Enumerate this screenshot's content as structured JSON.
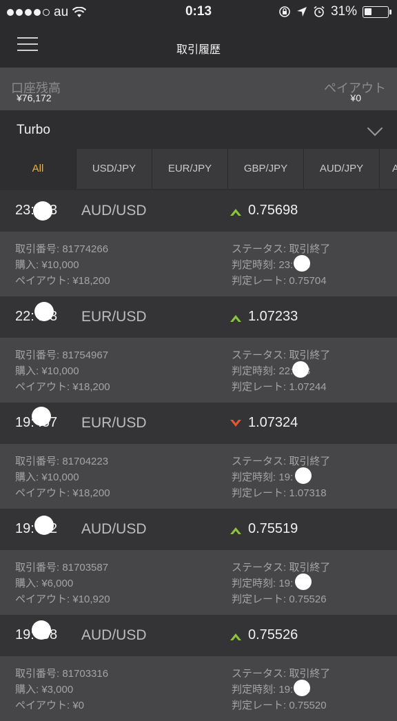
{
  "status_bar": {
    "carrier": "au",
    "time": "0:13",
    "battery": "31%",
    "battery_level": 0.31
  },
  "header": {
    "title": "取引履歴"
  },
  "balance": {
    "account_label": "口座残高",
    "account_value": "¥76,172",
    "payout_label": "ペイアウト",
    "payout_value": "¥0"
  },
  "mode": {
    "label": "Turbo"
  },
  "tabs": [
    "All",
    "USD/JPY",
    "EUR/JPY",
    "GBP/JPY",
    "AUD/JPY",
    "A"
  ],
  "colors": {
    "accent": "#f2b233",
    "up": "#8cc43f",
    "down": "#e8572e"
  },
  "trades": [
    {
      "time": "23:  :03",
      "pair": "AUD/USD",
      "direction": "up",
      "rate": "0.75698",
      "id": "取引番号: 81774266",
      "purchase": "購入: ¥10,000",
      "payout": "ペイアウト: ¥18,200",
      "status": "ステータス: 取引終了",
      "judge_time": "判定時刻: 23:  :03",
      "judge_rate": "判定レート: 0.75704"
    },
    {
      "time": "22:  :03",
      "pair": "EUR/USD",
      "direction": "up",
      "rate": "1.07233",
      "id": "取引番号: 81754967",
      "purchase": "購入: ¥10,000",
      "payout": "ペイアウト: ¥18,200",
      "status": "ステータス: 取引終了",
      "judge_time": "判定時刻: 22:  :03",
      "judge_rate": "判定レート: 1.07244"
    },
    {
      "time": "19:  :57",
      "pair": "EUR/USD",
      "direction": "down",
      "rate": "1.07324",
      "id": "取引番号: 81704223",
      "purchase": "購入: ¥10,000",
      "payout": "ペイアウト: ¥18,200",
      "status": "ステータス: 取引終了",
      "judge_time": "判定時刻: 19:  :57",
      "judge_rate": "判定レート: 1.07318"
    },
    {
      "time": "19:  :02",
      "pair": "AUD/USD",
      "direction": "up",
      "rate": "0.75519",
      "id": "取引番号: 81703587",
      "purchase": "購入: ¥6,000",
      "payout": "ペイアウト: ¥10,920",
      "status": "ステータス: 取引終了",
      "judge_time": "判定時刻: 19:  :02",
      "judge_rate": "判定レート: 0.75526"
    },
    {
      "time": "19:  :58",
      "pair": "AUD/USD",
      "direction": "up",
      "rate": "0.75526",
      "id": "取引番号: 81703316",
      "purchase": "購入: ¥3,000",
      "payout": "ペイアウト: ¥0",
      "status": "ステータス: 取引終了",
      "judge_time": "判定時刻: 19:  :58",
      "judge_rate": "判定レート: 0.75520"
    }
  ]
}
